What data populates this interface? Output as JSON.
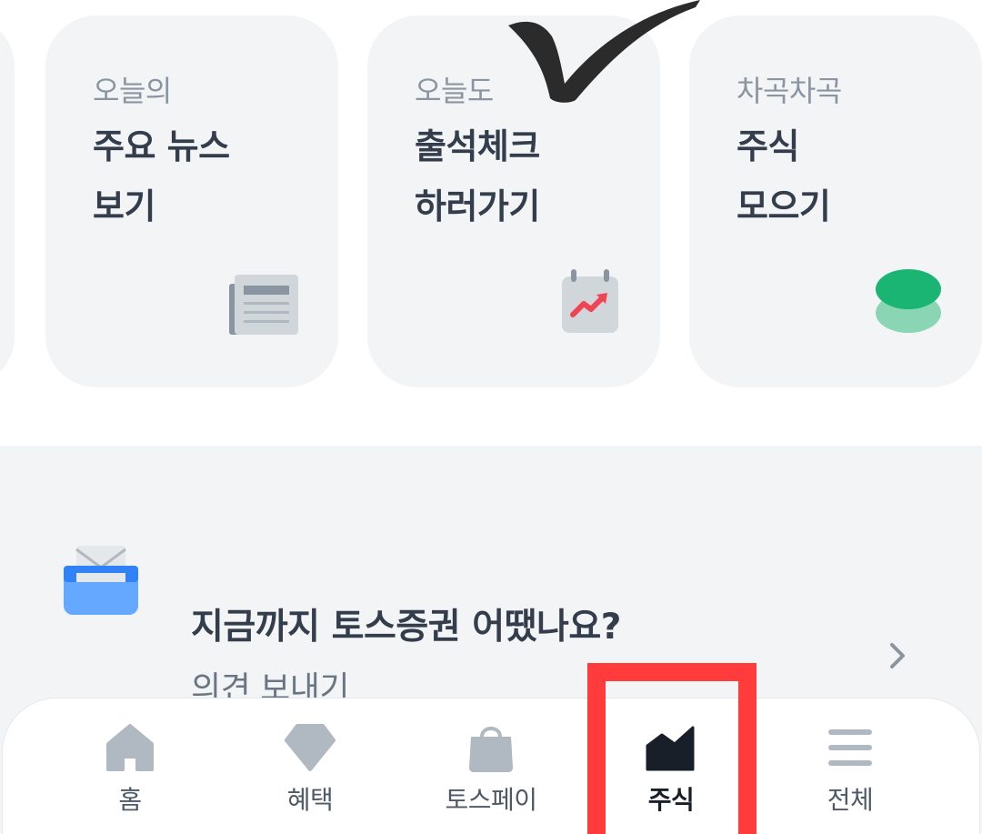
{
  "cards": [
    {
      "sub": "오늘의",
      "line1": "주요 뉴스",
      "line2": "보기",
      "icon": "newspaper-icon"
    },
    {
      "sub": "오늘도",
      "line1": "출석체크",
      "line2": "하러가기",
      "icon": "calendar-chart-icon"
    },
    {
      "sub": "차곡차곡",
      "line1": "주식",
      "line2": "모으기",
      "icon": "coin-stack-icon"
    }
  ],
  "feedback": {
    "title": "지금까지 토스증권 어땠나요?",
    "subtitle": "의견 보내기",
    "icon": "mailbox-icon"
  },
  "tabs": [
    {
      "label": "홈",
      "icon": "home-icon"
    },
    {
      "label": "혜택",
      "icon": "gem-icon"
    },
    {
      "label": "토스페이",
      "icon": "shopping-bag-icon"
    },
    {
      "label": "주식",
      "icon": "stock-chart-icon",
      "active": true
    },
    {
      "label": "전체",
      "icon": "menu-icon"
    }
  ],
  "colors": {
    "card_bg": "#f2f4f6",
    "tab_icon": "#b0b8c1",
    "tab_active": "#191f28",
    "highlight": "#ff3b3b",
    "accent_green": "#1bb573",
    "accent_red": "#f04452",
    "accent_blue": "#3182f6"
  }
}
